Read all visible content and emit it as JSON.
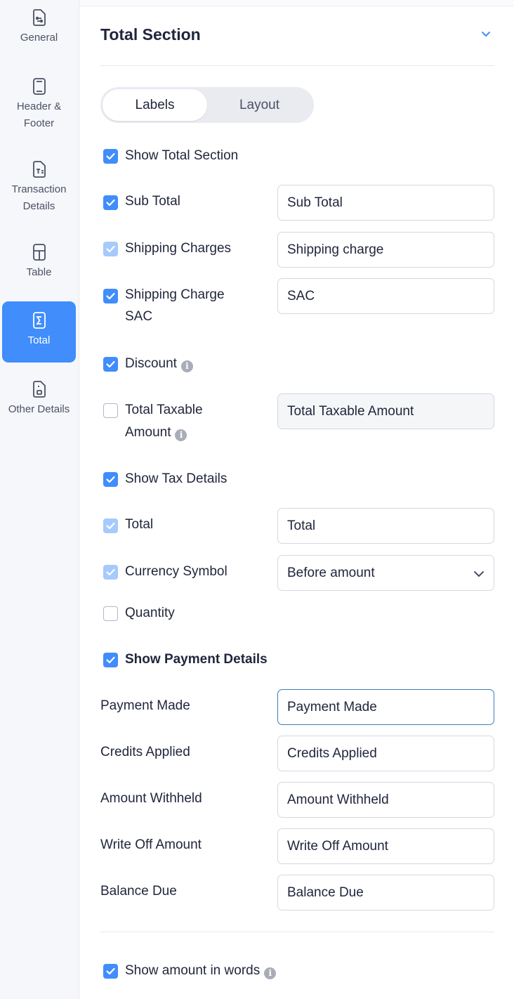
{
  "sidebar": {
    "items": [
      {
        "label": "General",
        "icon": "general-doc-icon"
      },
      {
        "label": "Header &\nFooter",
        "icon": "header-footer-icon"
      },
      {
        "label": "Transaction\nDetails",
        "icon": "transaction-details-icon"
      },
      {
        "label": "Table",
        "icon": "table-icon"
      },
      {
        "label": "Total",
        "icon": "sigma-icon",
        "active": true
      },
      {
        "label": "Other Details",
        "icon": "other-details-icon"
      }
    ],
    "accent": "#408dfb"
  },
  "section": {
    "title": "Total Section",
    "tabs": [
      "Labels",
      "Layout"
    ],
    "active_tab": "Labels"
  },
  "options": {
    "show_total_section": {
      "label": "Show Total Section",
      "checked": true
    },
    "sub_total": {
      "label": "Sub Total",
      "checked": true,
      "value": "Sub Total"
    },
    "shipping_charges": {
      "label": "Shipping Charges",
      "checked": true,
      "disabled": true,
      "value": "Shipping charge"
    },
    "shipping_charge_sac": {
      "label_line1": "Shipping Charge",
      "label_line2": "SAC",
      "checked": true,
      "value": "SAC"
    },
    "discount": {
      "label": "Discount",
      "checked": true
    },
    "total_taxable_amount": {
      "label_line1": "Total Taxable",
      "label_line2": "Amount",
      "checked": false,
      "value": "Total Taxable Amount"
    },
    "show_tax_details": {
      "label": "Show Tax Details",
      "checked": true
    },
    "total": {
      "label": "Total",
      "checked": true,
      "disabled": true,
      "value": "Total"
    },
    "currency_symbol": {
      "label": "Currency Symbol",
      "checked": true,
      "disabled": true,
      "selected": "Before amount"
    },
    "quantity": {
      "label": "Quantity",
      "checked": false
    },
    "show_payment_details": {
      "label": "Show Payment Details",
      "checked": true
    }
  },
  "payment": {
    "payment_made": {
      "label": "Payment Made",
      "value": "Payment Made"
    },
    "credits_applied": {
      "label": "Credits Applied",
      "value": "Credits Applied"
    },
    "amount_withheld": {
      "label": "Amount Withheld",
      "value": "Amount Withheld"
    },
    "write_off_amount": {
      "label": "Write Off Amount",
      "value": "Write Off Amount"
    },
    "balance_due": {
      "label": "Balance Due",
      "value": "Balance Due"
    }
  },
  "footer": {
    "show_amount_in_words": {
      "label": "Show amount in words",
      "checked": true
    }
  }
}
